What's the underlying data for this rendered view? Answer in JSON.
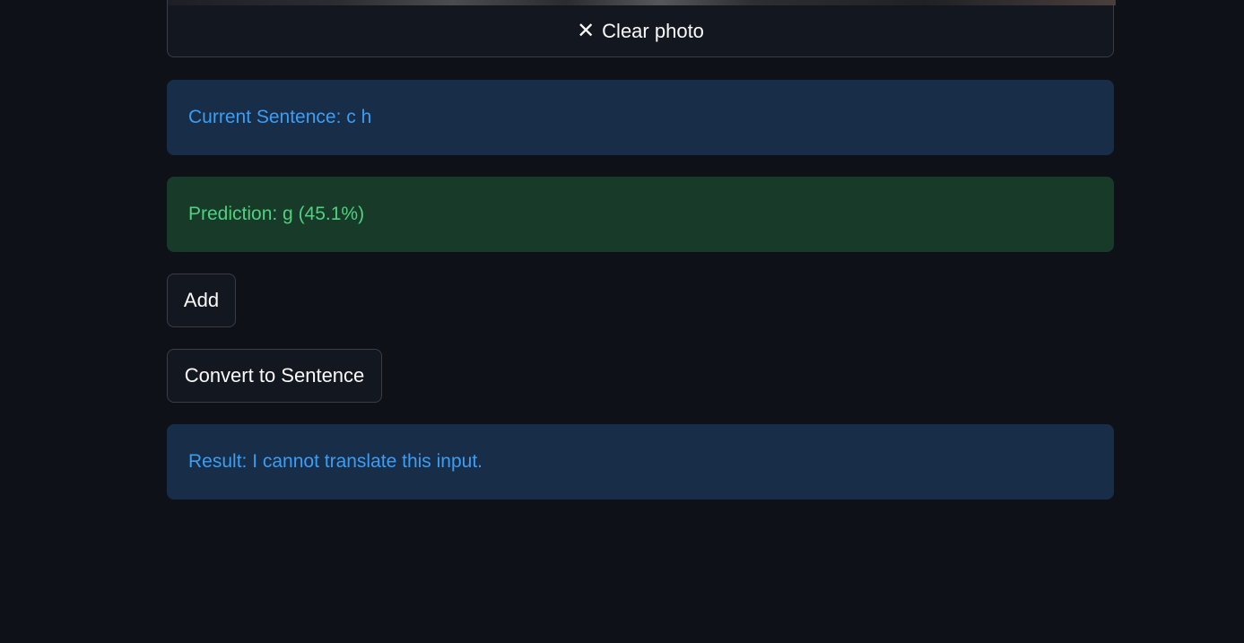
{
  "camera": {
    "clear_label": "Clear photo",
    "clear_icon": "close-icon"
  },
  "current_sentence": {
    "text": "Current Sentence: c h"
  },
  "prediction": {
    "text": "Prediction: g (45.1%)"
  },
  "actions": {
    "add_label": "Add",
    "convert_label": "Convert to Sentence"
  },
  "result": {
    "text": "Result: I cannot translate this input."
  },
  "colors": {
    "background": "#0e1117",
    "info_bg": "#172d48",
    "info_text": "#3d9df3",
    "success_bg": "#173a29",
    "success_text": "#4fd17f"
  }
}
